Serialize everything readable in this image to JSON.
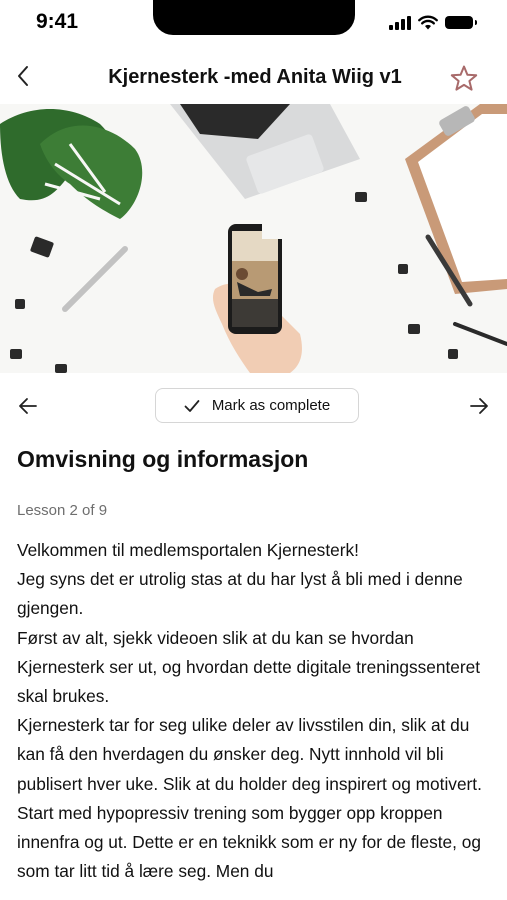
{
  "status_bar": {
    "time": "9:41"
  },
  "header": {
    "title": "Kjernesterk -med Anita Wiig v1"
  },
  "icons": {
    "back": "chevron-left-icon",
    "favorite": "star-outline-icon",
    "prev": "arrow-left-icon",
    "next": "arrow-right-icon",
    "check": "checkmark-icon"
  },
  "colors": {
    "star": "#a86a6a",
    "text": "#111111",
    "muted": "#6e6e6e"
  },
  "lesson_nav": {
    "mark_complete_label": "Mark as complete"
  },
  "content": {
    "heading": "Omvisning og informasjon",
    "lesson_label": "Lesson 2 of 9",
    "paragraphs": [
      "Velkommen til medlemsportalen Kjernesterk!",
      "Jeg syns det er utrolig stas at du har lyst å bli med i denne gjengen.",
      "Først av alt, sjekk videoen slik at du kan se hvordan Kjernesterk ser ut, og hvordan dette digitale treningssenteret skal brukes.",
      "Kjernesterk tar for seg ulike deler av livsstilen din, slik at du kan få den hverdagen du ønsker deg. Nytt innhold vil bli publisert hver uke. Slik at du holder deg inspirert og motivert.",
      "Start med hypopressiv trening som bygger opp kroppen innenfra og ut. Dette er en teknikk som er ny for de fleste, og som tar litt tid å lære seg. Men du"
    ]
  }
}
